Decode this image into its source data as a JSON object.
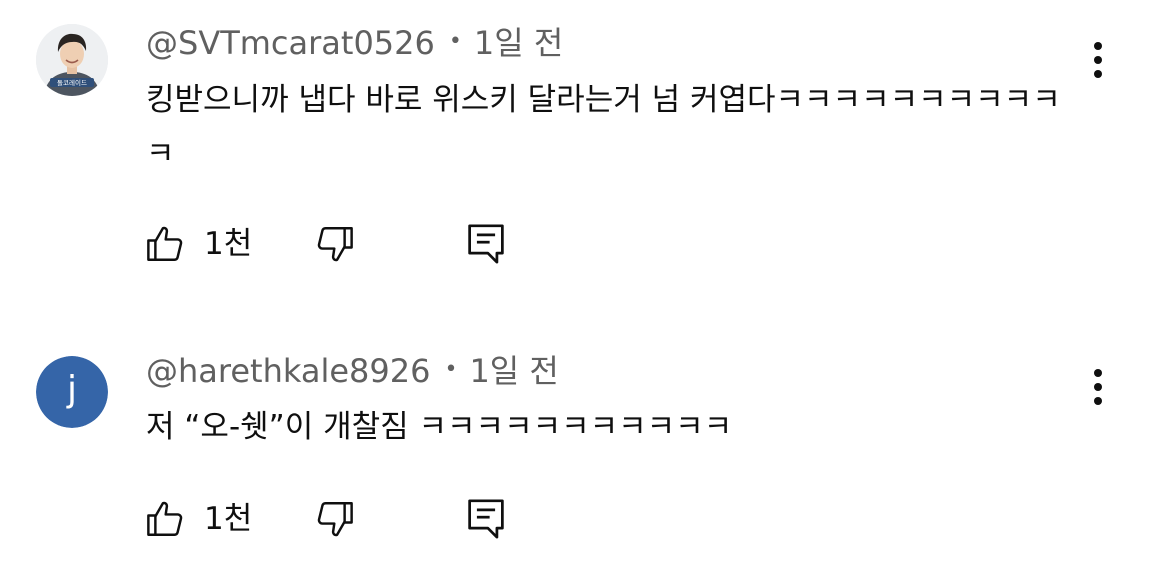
{
  "comments": [
    {
      "author": "@SVTmcarat0526",
      "separator": "•",
      "time": "1일 전",
      "text": "킹받으니까 냅다 바로 위스키 달라는거 넘 커엽다ㅋㅋㅋㅋㅋㅋㅋㅋㅋㅋㅋ",
      "avatar": {
        "type": "photo",
        "caption": "돌코레이드"
      },
      "likes": "1천"
    },
    {
      "author": "@harethkale8926",
      "separator": "•",
      "time": "1일 전",
      "text": "저 “오-쉣”이 개찰짐 ㅋㅋㅋㅋㅋㅋㅋㅋㅋㅋㅋ",
      "avatar": {
        "type": "letter",
        "letter": "j",
        "color": "#3565a8"
      },
      "likes": "1천"
    }
  ],
  "icons": {
    "like": "thumbs-up-icon",
    "dislike": "thumbs-down-icon",
    "reply": "comment-reply-icon",
    "more": "more-vertical-icon"
  }
}
